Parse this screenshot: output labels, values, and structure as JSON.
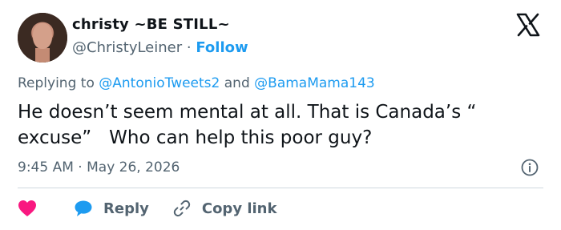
{
  "author": {
    "name": "christy ~BE STILL~",
    "handle": "@ChristyLeiner",
    "separator": "·",
    "follow_label": "Follow"
  },
  "platform": {
    "logo_icon": "x-logo-icon"
  },
  "reply_context": {
    "prefix": "Replying to",
    "mention_1": "@AntonioTweets2",
    "conjunction": "and",
    "mention_2": "@BamaMama143"
  },
  "tweet": {
    "text": "He doesn’t seem mental at all. That is Canada’s “\nexcuse”   Who can help this poor guy?"
  },
  "meta": {
    "time": "9:45 AM",
    "separator": "·",
    "date": "May 26, 2026",
    "info_icon": "info-icon"
  },
  "actions": {
    "like_icon": "heart-icon",
    "reply_icon": "speech-bubble-icon",
    "reply_label": "Reply",
    "copy_icon": "link-icon",
    "copy_label": "Copy link"
  },
  "colors": {
    "accent": "#1d9bf0",
    "like": "#f91880",
    "secondary_text": "#536471",
    "primary_text": "#0f1419"
  }
}
